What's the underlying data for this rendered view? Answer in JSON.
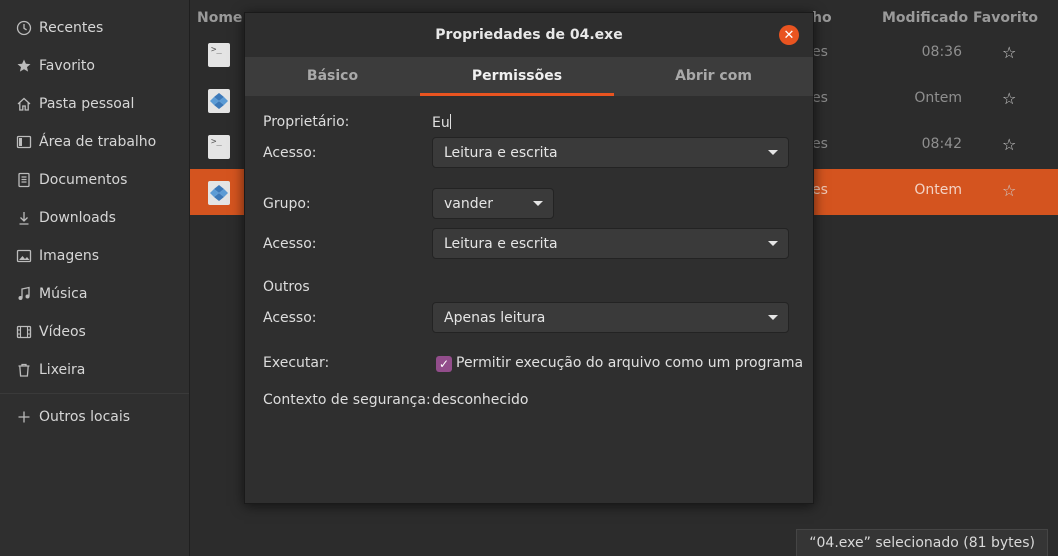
{
  "sidebar": {
    "items": [
      {
        "label": "Recentes",
        "icon": "clock-icon"
      },
      {
        "label": "Favorito",
        "icon": "star-icon"
      },
      {
        "label": "Pasta pessoal",
        "icon": "home-icon"
      },
      {
        "label": "Área de trabalho",
        "icon": "desktop-icon"
      },
      {
        "label": "Documentos",
        "icon": "document-icon"
      },
      {
        "label": "Downloads",
        "icon": "download-icon"
      },
      {
        "label": "Imagens",
        "icon": "image-icon"
      },
      {
        "label": "Música",
        "icon": "music-icon"
      },
      {
        "label": "Vídeos",
        "icon": "video-icon"
      },
      {
        "label": "Lixeira",
        "icon": "trash-icon"
      }
    ],
    "other_locations": "Outros locais"
  },
  "file_list": {
    "columns": {
      "name": "Nome",
      "size_fragment": "ho",
      "modified": "Modificado",
      "favorite": "Favorito"
    },
    "rows": [
      {
        "icon": "terminal-file-icon",
        "size_fragment": "es",
        "modified": "08:36",
        "selected": false
      },
      {
        "icon": "exe-file-icon",
        "size_fragment": "es",
        "modified": "Ontem",
        "selected": false
      },
      {
        "icon": "terminal-file-icon",
        "size_fragment": "es",
        "modified": "08:42",
        "selected": false
      },
      {
        "icon": "exe-file-icon",
        "size_fragment": "es",
        "modified": "Ontem",
        "selected": true
      }
    ],
    "favorite_glyph": "☆",
    "selection_color": "#d4541f"
  },
  "status_bar": {
    "text": "“04.exe” selecionado  (81 bytes)"
  },
  "dialog": {
    "title": "Propriedades de 04.exe",
    "close_glyph": "✕",
    "tabs": [
      {
        "label": "Básico",
        "active": false
      },
      {
        "label": "Permissões",
        "active": true
      },
      {
        "label": "Abrir com",
        "active": false
      }
    ],
    "owner_label": "Proprietário:",
    "owner_value": "Eu",
    "owner_access_label": "Acesso:",
    "owner_access_value": "Leitura e escrita",
    "group_label": "Grupo:",
    "group_value": "vander",
    "group_access_label": "Acesso:",
    "group_access_value": "Leitura e escrita",
    "others_label": "Outros",
    "others_access_label": "Acesso:",
    "others_access_value": "Apenas leitura",
    "execute_label": "Executar:",
    "execute_checkbox_label": "Permitir execução do arquivo como um programa",
    "execute_checked": true,
    "security_context_label": "Contexto de segurança:",
    "security_context_value": "desconhecido",
    "accent_color": "#e95420",
    "checkbox_color": "#924d8b"
  }
}
